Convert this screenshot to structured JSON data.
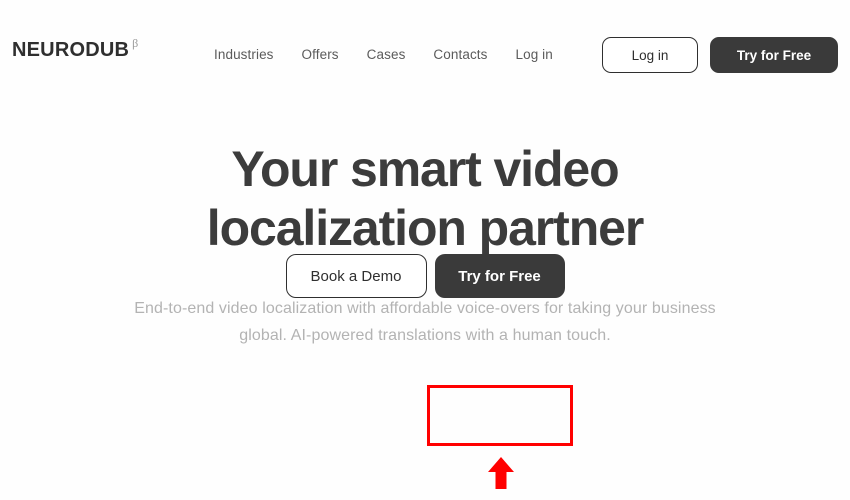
{
  "page": {
    "background_color": "#fefefe",
    "accent_color": "#3a3a3a",
    "annotation_color": "#ff0000"
  },
  "header": {
    "logo": {
      "word": "NEURODUB",
      "beta": "β"
    },
    "nav": [
      {
        "label": "Industries"
      },
      {
        "label": "Offers"
      },
      {
        "label": "Cases"
      },
      {
        "label": "Contacts"
      },
      {
        "label": "Log in"
      }
    ],
    "actions": {
      "login_label": "Log in",
      "try_label": "Try for Free"
    }
  },
  "hero": {
    "title_line_1": "Your smart video",
    "title_line_2": "localization partner",
    "subtitle_line_1": "End-to-end video localization with affordable voice-overs for taking your",
    "subtitle_line_2": "business global. AI-powered translations with a human touch.",
    "actions": {
      "demo_label": "Book a Demo",
      "try_label": "Try for Free"
    }
  },
  "annotations": {
    "highlight_target": "Try for Free",
    "arrow_direction": "up"
  }
}
